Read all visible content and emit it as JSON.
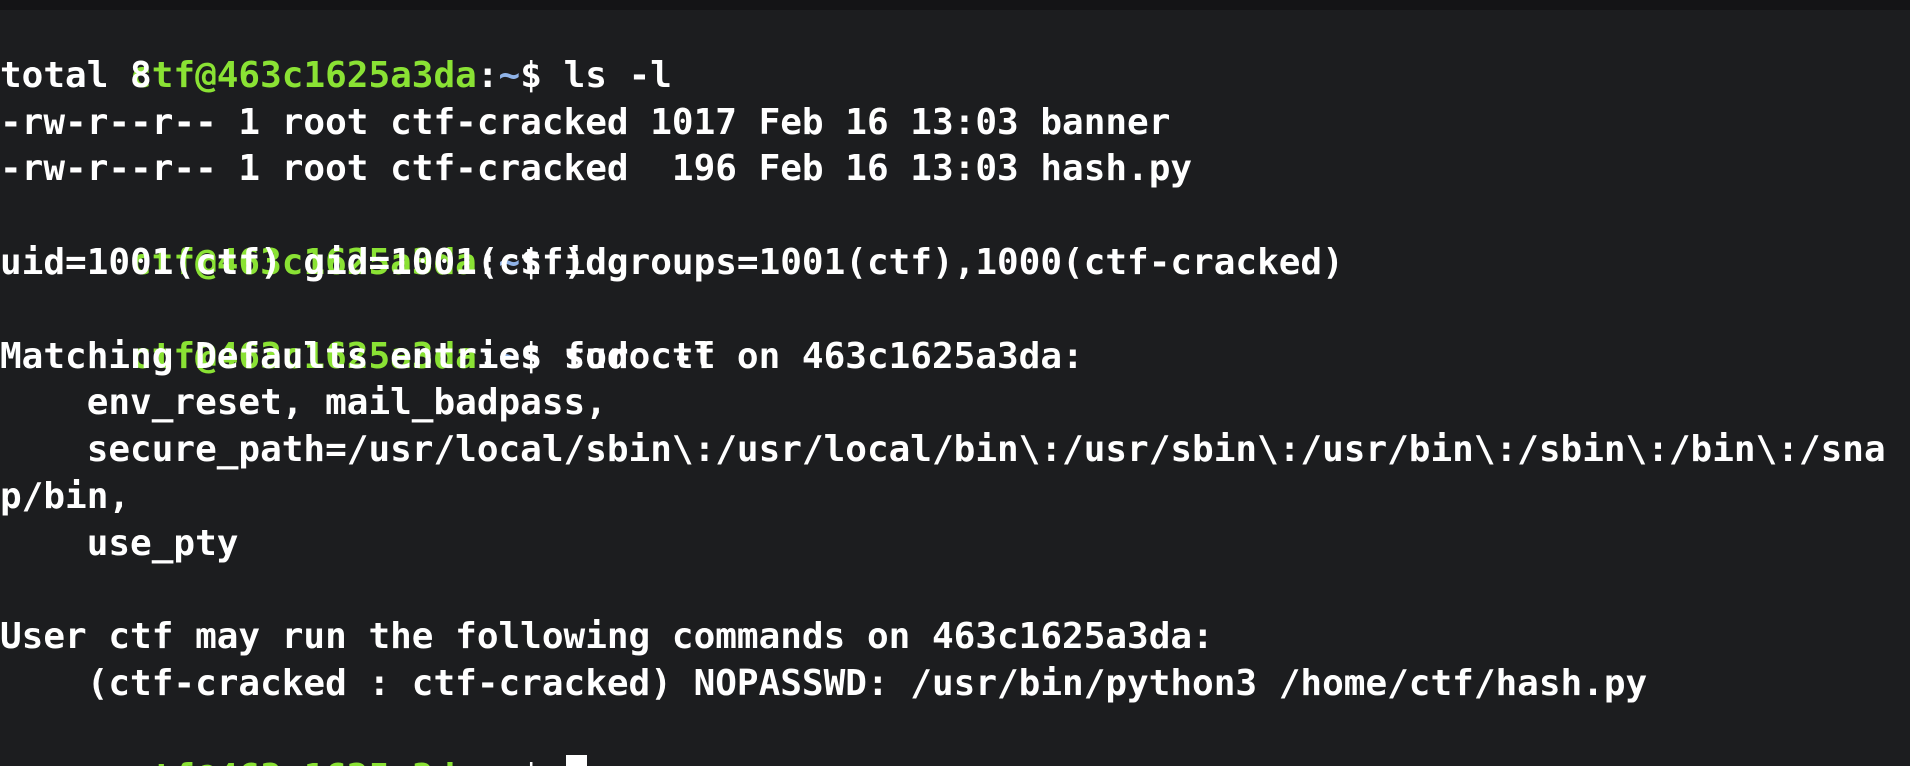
{
  "prompt": {
    "user_host": "ctf@463c1625a3da",
    "colon": ":",
    "path": "~",
    "dollar": "$ "
  },
  "commands": {
    "ls": "ls -l",
    "id": "id",
    "sudo": "sudo -l",
    "current": ""
  },
  "output": {
    "total": "total 8",
    "file_banner": "-rw-r--r-- 1 root ctf-cracked 1017 Feb 16 13:03 banner",
    "file_hash": "-rw-r--r-- 1 root ctf-cracked  196 Feb 16 13:03 hash.py",
    "id_result": "uid=1001(ctf) gid=1001(ctf) groups=1001(ctf),1000(ctf-cracked)",
    "matching_defaults": "Matching Defaults entries for ctf on 463c1625a3da:",
    "env_reset": "    env_reset, mail_badpass,",
    "secure_path": "    secure_path=/usr/local/sbin\\:/usr/local/bin\\:/usr/sbin\\:/usr/bin\\:/sbin\\:/bin\\:/sna",
    "secure_path_wrap": "p/bin,",
    "use_pty": "    use_pty",
    "blank": "",
    "user_may_run": "User ctf may run the following commands on 463c1625a3da:",
    "nopasswd_rule": "    (ctf-cracked : ctf-cracked) NOPASSWD: /usr/bin/python3 /home/ctf/hash.py"
  },
  "colors": {
    "background": "#1c1d1f",
    "prompt_user_host": "#8ae234",
    "prompt_path": "#8fb3e8",
    "text": "#ffffff"
  }
}
